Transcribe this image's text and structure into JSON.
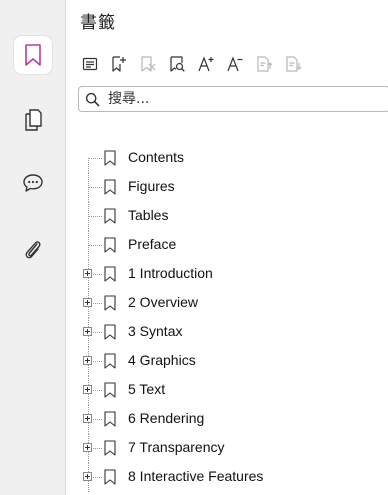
{
  "sidebar": {
    "tabs": [
      {
        "name": "bookmarks",
        "icon": "bookmark-icon",
        "active": true
      },
      {
        "name": "pages",
        "icon": "pages-icon",
        "active": false
      },
      {
        "name": "comments",
        "icon": "comment-icon",
        "active": false
      },
      {
        "name": "attachments",
        "icon": "paperclip-icon",
        "active": false
      }
    ],
    "accent_color": "#c0399e"
  },
  "panel": {
    "title": "書籤",
    "toolbar": [
      {
        "icon": "expand-all-icon",
        "enabled": true
      },
      {
        "icon": "add-bookmark-icon",
        "enabled": true
      },
      {
        "icon": "delete-bookmark-icon",
        "enabled": false
      },
      {
        "icon": "find-bookmark-icon",
        "enabled": true
      },
      {
        "icon": "increase-font-icon",
        "enabled": true
      },
      {
        "icon": "decrease-font-icon",
        "enabled": true
      },
      {
        "icon": "move-up-icon",
        "enabled": false
      },
      {
        "icon": "move-down-icon",
        "enabled": false
      }
    ],
    "search": {
      "placeholder": "搜尋..."
    }
  },
  "bookmarks": [
    {
      "label": "Contents",
      "expandable": false
    },
    {
      "label": "Figures",
      "expandable": false
    },
    {
      "label": "Tables",
      "expandable": false
    },
    {
      "label": "Preface",
      "expandable": false
    },
    {
      "label": "1 Introduction",
      "expandable": true
    },
    {
      "label": "2 Overview",
      "expandable": true
    },
    {
      "label": "3 Syntax",
      "expandable": true
    },
    {
      "label": "4 Graphics",
      "expandable": true
    },
    {
      "label": "5 Text",
      "expandable": true
    },
    {
      "label": "6 Rendering",
      "expandable": true
    },
    {
      "label": "7 Transparency",
      "expandable": true
    },
    {
      "label": "8 Interactive Features",
      "expandable": true
    }
  ]
}
